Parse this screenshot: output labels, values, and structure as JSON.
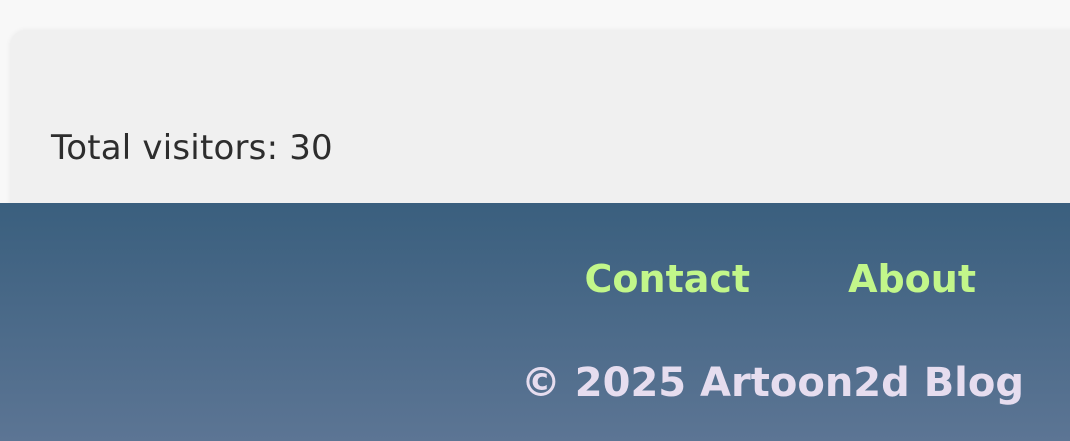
{
  "stats": {
    "visitors_text": "Total visitors: 30"
  },
  "footer": {
    "nav": [
      {
        "label": "Contact"
      },
      {
        "label": "About"
      }
    ],
    "copyright": "© 2025 Artoon2d Blog"
  },
  "colors": {
    "footer_top": "#3a5f7e",
    "footer_bottom": "#5c7594",
    "link": "#c2f68a",
    "copyright": "#e6ddef",
    "card_bg": "#f0f0f0"
  }
}
